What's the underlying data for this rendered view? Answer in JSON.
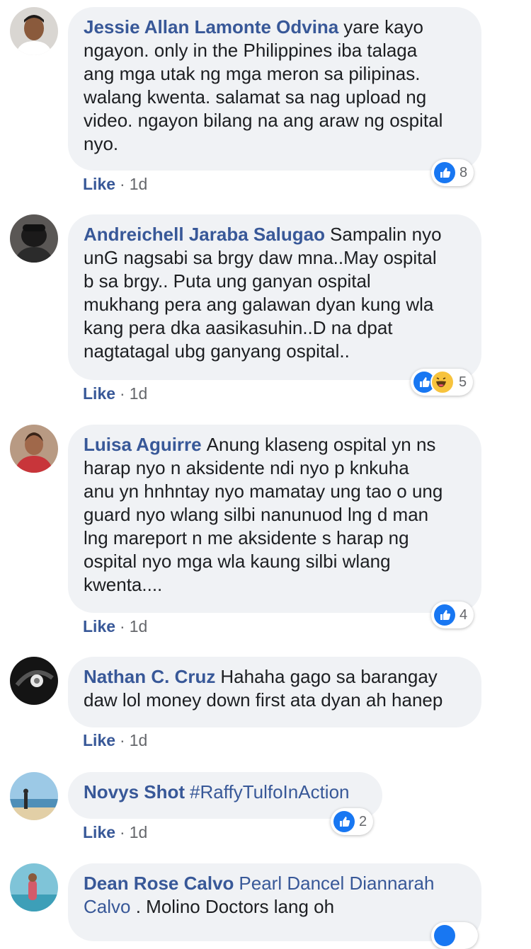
{
  "comments": [
    {
      "author": "Jessie Allan Lamonte Odvina",
      "text_lines": [
        "yare kayo",
        "ngayon. only in the Philippines iba talaga",
        "ang mga utak ng mga meron sa pilipinas.",
        "walang kwenta. salamat sa nag upload ng",
        "video. ngayon bilang na ang araw ng ospital",
        "nyo."
      ],
      "like_label": "Like",
      "separator": "·",
      "time": "1d",
      "reaction_count": "8"
    },
    {
      "author": "Andreichell Jaraba Salugao",
      "text_lines": [
        "Sampalin nyo",
        "unG nagsabi sa brgy daw mna..May ospital",
        "b sa brgy.. Puta ung ganyan ospital",
        "mukhang pera ang galawan dyan kung wla",
        "kang pera dka aasikasuhin..D na dpat",
        "nagtatagal ubg ganyang ospital.."
      ],
      "like_label": "Like",
      "separator": "·",
      "time": "1d",
      "reaction_count": "5"
    },
    {
      "author": "Luisa Aguirre",
      "text_lines": [
        "Anung klaseng ospital yn ns",
        "harap nyo n aksidente ndi nyo p knkuha",
        "anu yn hnhntay nyo mamatay ung tao o ung",
        "guard nyo wlang silbi nanunuod lng d man",
        "lng mareport n me aksidente s harap ng",
        "ospital nyo mga wla kaung silbi wlang",
        "kwenta...."
      ],
      "like_label": "Like",
      "separator": "·",
      "time": "1d",
      "reaction_count": "4"
    },
    {
      "author": "Nathan C. Cruz",
      "text_lines": [
        "Hahaha gago sa barangay",
        "daw lol money down first ata dyan ah hanep"
      ],
      "like_label": "Like",
      "separator": "·",
      "time": "1d"
    },
    {
      "author": "Novys Shot",
      "text_lines": [
        "#RaffyTulfoInAction"
      ],
      "like_label": "Like",
      "separator": "·",
      "time": "1d",
      "reaction_count": "2"
    },
    {
      "author": "Dean Rose Calvo",
      "mention": "Pearl Dancel Diannarah",
      "text_lines": [
        "Calvo",
        ". Molino Doctors lang oh"
      ]
    }
  ],
  "colors": {
    "author": "#385898",
    "bubble": "#f0f2f5",
    "like_reaction": "#1877f2",
    "haha_reaction": "#f7c33d"
  },
  "icons": [
    "like-reaction-icon",
    "haha-reaction-icon"
  ]
}
